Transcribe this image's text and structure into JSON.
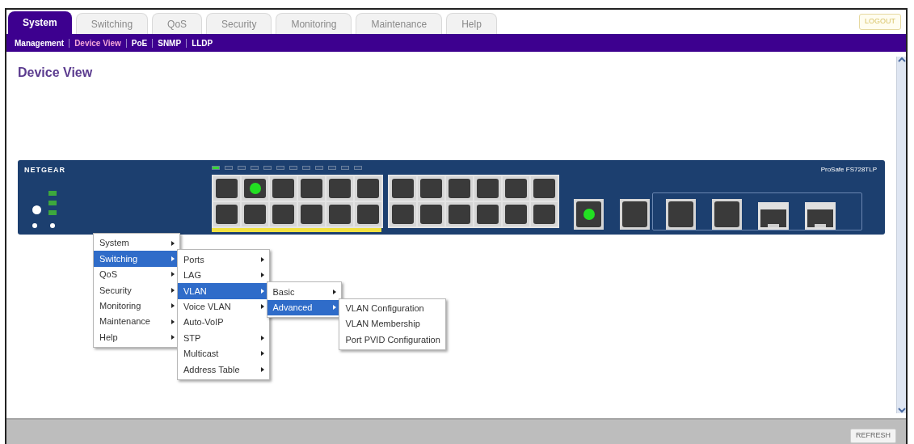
{
  "tabs": [
    {
      "label": "System",
      "selected": true
    },
    {
      "label": "Switching",
      "selected": false
    },
    {
      "label": "QoS",
      "selected": false
    },
    {
      "label": "Security",
      "selected": false
    },
    {
      "label": "Monitoring",
      "selected": false
    },
    {
      "label": "Maintenance",
      "selected": false
    },
    {
      "label": "Help",
      "selected": false
    }
  ],
  "logout": "LOGOUT",
  "subnav": [
    {
      "label": "Management",
      "selected": false
    },
    {
      "label": "Device View",
      "selected": true
    },
    {
      "label": "PoE",
      "selected": false
    },
    {
      "label": "SNMP",
      "selected": false
    },
    {
      "label": "LLDP",
      "selected": false
    }
  ],
  "page_title": "Device View",
  "switch_panel": {
    "brand": "NETGEAR",
    "model": "ProSafe FS728TLP",
    "ports": [
      {
        "link": false
      },
      {
        "link": true
      },
      {
        "link": false
      },
      {
        "link": false
      },
      {
        "link": false
      },
      {
        "link": false
      },
      {
        "link": false
      },
      {
        "link": false
      },
      {
        "link": false
      },
      {
        "link": false
      },
      {
        "link": false
      },
      {
        "link": false
      },
      {
        "link": false
      },
      {
        "link": false
      },
      {
        "link": false
      },
      {
        "link": false
      },
      {
        "link": false
      },
      {
        "link": false
      },
      {
        "link": false
      },
      {
        "link": false
      },
      {
        "link": false
      },
      {
        "link": false
      },
      {
        "link": false
      },
      {
        "link": false
      }
    ],
    "uplinks": [
      {
        "kind": "rj45",
        "link": true
      },
      {
        "kind": "rj45",
        "link": false
      },
      {
        "kind": "rj45",
        "link": false
      },
      {
        "kind": "rj45",
        "link": false
      },
      {
        "kind": "sfp",
        "link": false
      },
      {
        "kind": "sfp",
        "link": false
      }
    ]
  },
  "menu": [
    {
      "label": "System",
      "arrow": true,
      "selected": false
    },
    {
      "label": "Switching",
      "arrow": true,
      "selected": true,
      "children": [
        {
          "label": "Ports",
          "arrow": true,
          "selected": false
        },
        {
          "label": "LAG",
          "arrow": true,
          "selected": false
        },
        {
          "label": "VLAN",
          "arrow": true,
          "selected": true,
          "children": [
            {
              "label": "Basic",
              "arrow": true,
              "selected": false
            },
            {
              "label": "Advanced",
              "arrow": true,
              "selected": true,
              "children": [
                {
                  "label": "VLAN Configuration",
                  "arrow": false,
                  "selected": false
                },
                {
                  "label": "VLAN Membership",
                  "arrow": false,
                  "selected": false
                },
                {
                  "label": "Port PVID Configuration",
                  "arrow": false,
                  "selected": false
                }
              ]
            }
          ]
        },
        {
          "label": "Voice VLAN",
          "arrow": true,
          "selected": false
        },
        {
          "label": "Auto-VoIP",
          "arrow": false,
          "selected": false
        },
        {
          "label": "STP",
          "arrow": true,
          "selected": false
        },
        {
          "label": "Multicast",
          "arrow": true,
          "selected": false
        },
        {
          "label": "Address Table",
          "arrow": true,
          "selected": false
        }
      ]
    },
    {
      "label": "QoS",
      "arrow": true,
      "selected": false
    },
    {
      "label": "Security",
      "arrow": true,
      "selected": false
    },
    {
      "label": "Monitoring",
      "arrow": true,
      "selected": false
    },
    {
      "label": "Maintenance",
      "arrow": true,
      "selected": false
    },
    {
      "label": "Help",
      "arrow": true,
      "selected": false
    }
  ],
  "refresh": "REFRESH"
}
